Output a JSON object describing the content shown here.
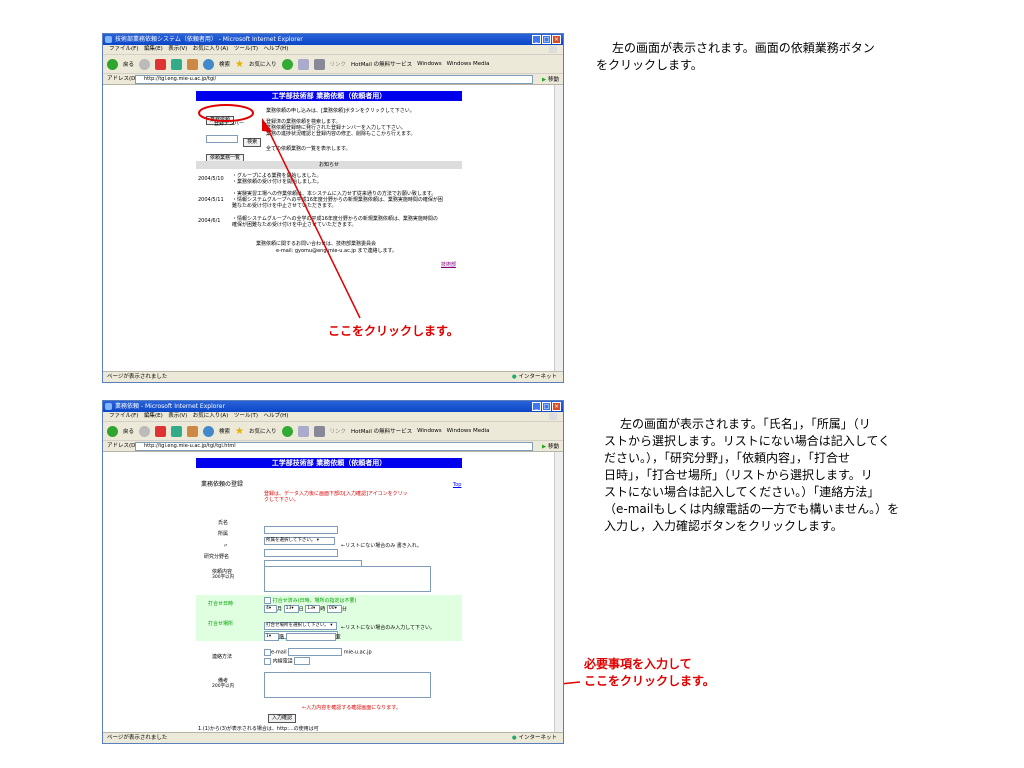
{
  "ie": {
    "menu": "ファイル(F)　編集(E)　表示(V)　お気に入り(A)　ツール(T)　ヘルプ(H)",
    "toolbar": {
      "back": "戻る",
      "search": "検索",
      "favorites": "お気に入り",
      "links": "リンク",
      "hotmail": "HotMail の無料サービス",
      "windows": "Windows",
      "media": "Windows Media"
    },
    "address_label": "アドレス(D)",
    "go": "移動",
    "zone": "インターネット",
    "status_text": "ページが表示されました"
  },
  "top": {
    "window_title": "技術部業務依頼システム（依頼者用） - Microsoft Internet Explorer",
    "url": "http://tgi.eng.mie-u.ac.jp/tgi/",
    "header": "工学部技術部 業務依頼（依頼者用）",
    "btn_request": "業務依頼",
    "request_desc": "業務依頼の申し込みは、[業務依頼]ボタンをクリックして下さい。",
    "reg_label": "登録ナンバー",
    "btn_search": "検索",
    "search_desc": [
      "登録済の業務依頼を検索します。",
      "業務依頼登録時に発行された登録ナンバーを入力して下さい。",
      "業務の進捗状況確認と登録内容の修正、削除もここから行えます。"
    ],
    "btn_list": "依頼業務一覧",
    "list_desc": "全ての依頼業務の一覧を表示します。",
    "notice_header": "お知らせ",
    "notices": [
      {
        "date": "2004/5/10",
        "lines": [
          "・グループによる業務を開始しました。",
          "・業務依頼の受け付けを開始しました。"
        ]
      },
      {
        "date": "2004/5/11",
        "lines": [
          "・実験実習工場への作業依頼は、本システムに入力せず従来通りの方法でお願い致します。",
          "・情報システムグループへの平成16年度分野からの新規業務依頼は、業務実施時間の確保が困",
          "難なため受け付けを中止させていただきます。"
        ]
      },
      {
        "date": "2004/6/1",
        "lines": [
          "・情報システムグループへの全学の平成16年度分野からの新規業務依頼は、業務実施時間の",
          "確保が困難なため受け付けを中止させていただきます。"
        ]
      }
    ],
    "contact": [
      "業務依頼に関するお問い合わせは、技術部業務委員会",
      "e-mail: gyomu@eng.mie-u.ac.jp まで連絡します。"
    ],
    "footer_link": "技術部",
    "callout": "ここをクリックします。",
    "note": [
      "左の画面が表示されます。画面の依頼業務ボタン",
      "をクリックします。"
    ]
  },
  "bottom": {
    "window_title": "業務依頼 - Microsoft Internet Explorer",
    "url": "http://tgi.eng.mie-u.ac.jp/tgi/tgi.html",
    "header": "工学部技術部 業務依頼（依頼者用）",
    "section": "業務依頼の登録",
    "top_link": "Top",
    "instruction": [
      "登録は、データ入力後に画面下部の[入力確認]アイコンをクリッ",
      "クして下さい。"
    ],
    "labels": {
      "name": "氏名",
      "affiliation": "所属",
      "ditto": "〃",
      "field": "研究分野名",
      "content": "依頼内容",
      "content_limit": "300字以内",
      "datetime": "打合せ日時",
      "place": "打合せ場所",
      "contact": "連絡方法",
      "remarks": "備考",
      "remarks_limit": "200字以内"
    },
    "affiliation_select": "所属を選択して下さい。",
    "affiliation_hint": "←リストにない場合のみ 書き入れ。",
    "done_check": "打合せ済み(日時、場所の指定は不要)",
    "dt": {
      "month": "4",
      "month_unit": "月",
      "day": "13",
      "day_unit": "日",
      "hour": "13",
      "hour_unit": "時",
      "min": "00",
      "min_unit": "分"
    },
    "place_select": "打合せ場所を選択して下さい。",
    "place_hint": "←リストにない場合のみ入力して下さい。",
    "floor": "1",
    "floor_unit": "階",
    "room_unit": "室",
    "email_label": "e-mail",
    "email_domain": "mie-u.ac.jp",
    "phone_label": "内線電話",
    "btn_confirm": "入力確認",
    "confirm_hint": "←入力内容を確認する確認画面になります。",
    "cut_text": "1.(1)から(3)が表示される場合は、http:...の使用は可",
    "callout": [
      "必要事項を入力して",
      "ここをクリックします。"
    ],
    "note": [
      "左の画面が表示されます。「氏名」，「所属」（リ",
      "ストから選択します。リストにない場合は記入してく",
      "ださい。），「研究分野」，「依頼内容」，「打合せ",
      "日時」，「打合せ場所」（リストから選択します。リ",
      "ストにない場合は記入してください。）「連絡方法」",
      "（e-mailもしくは内線電話の一方でも構いません。）を",
      "入力し，入力確認ボタンをクリックします。"
    ]
  },
  "colors": {
    "ie_blue": "#0b46c8",
    "header_blue": "#0000ee",
    "callout_red": "#e00000",
    "green_band": "#e0ffe0"
  },
  "icons": [
    "ie-logo-icon",
    "back-icon",
    "forward-icon",
    "stop-icon",
    "refresh-icon",
    "home-icon",
    "search-icon",
    "favorites-icon",
    "history-icon",
    "mail-icon",
    "print-icon",
    "go-icon",
    "globe-icon",
    "red-arrow"
  ]
}
